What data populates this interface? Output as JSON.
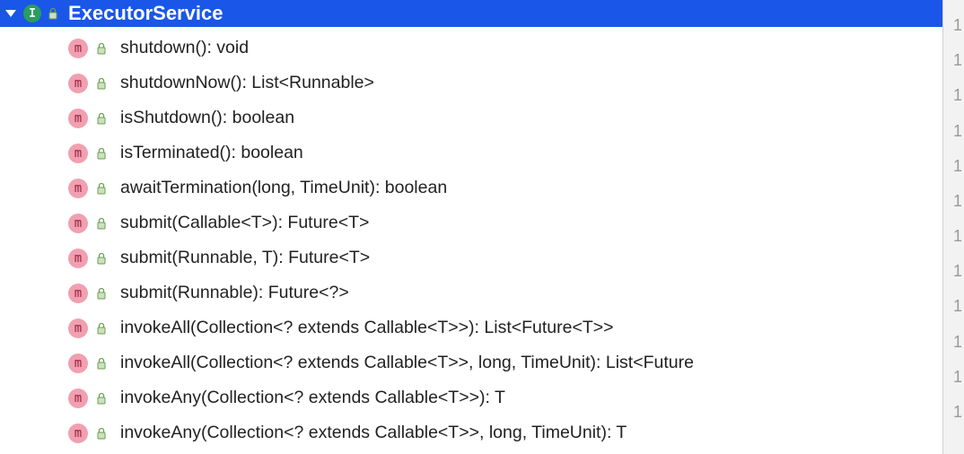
{
  "header": {
    "interface_letter": "I",
    "title": "ExecutorService"
  },
  "methods": [
    {
      "signature": "shutdown(): void"
    },
    {
      "signature": "shutdownNow(): List<Runnable>"
    },
    {
      "signature": "isShutdown(): boolean"
    },
    {
      "signature": "isTerminated(): boolean"
    },
    {
      "signature": "awaitTermination(long, TimeUnit): boolean"
    },
    {
      "signature": "submit(Callable<T>): Future<T>"
    },
    {
      "signature": "submit(Runnable, T): Future<T>"
    },
    {
      "signature": "submit(Runnable): Future<?>"
    },
    {
      "signature": "invokeAll(Collection<? extends Callable<T>>): List<Future<T>>"
    },
    {
      "signature": "invokeAll(Collection<? extends Callable<T>>, long, TimeUnit): List<Future"
    },
    {
      "signature": "invokeAny(Collection<? extends Callable<T>>): T"
    },
    {
      "signature": "invokeAny(Collection<? extends Callable<T>>, long, TimeUnit): T"
    }
  ],
  "method_letter": "m",
  "line_numbers": [
    "1",
    "1",
    "1",
    "1",
    "1",
    "1",
    "1",
    "1",
    "1",
    "1",
    "1",
    "1"
  ]
}
